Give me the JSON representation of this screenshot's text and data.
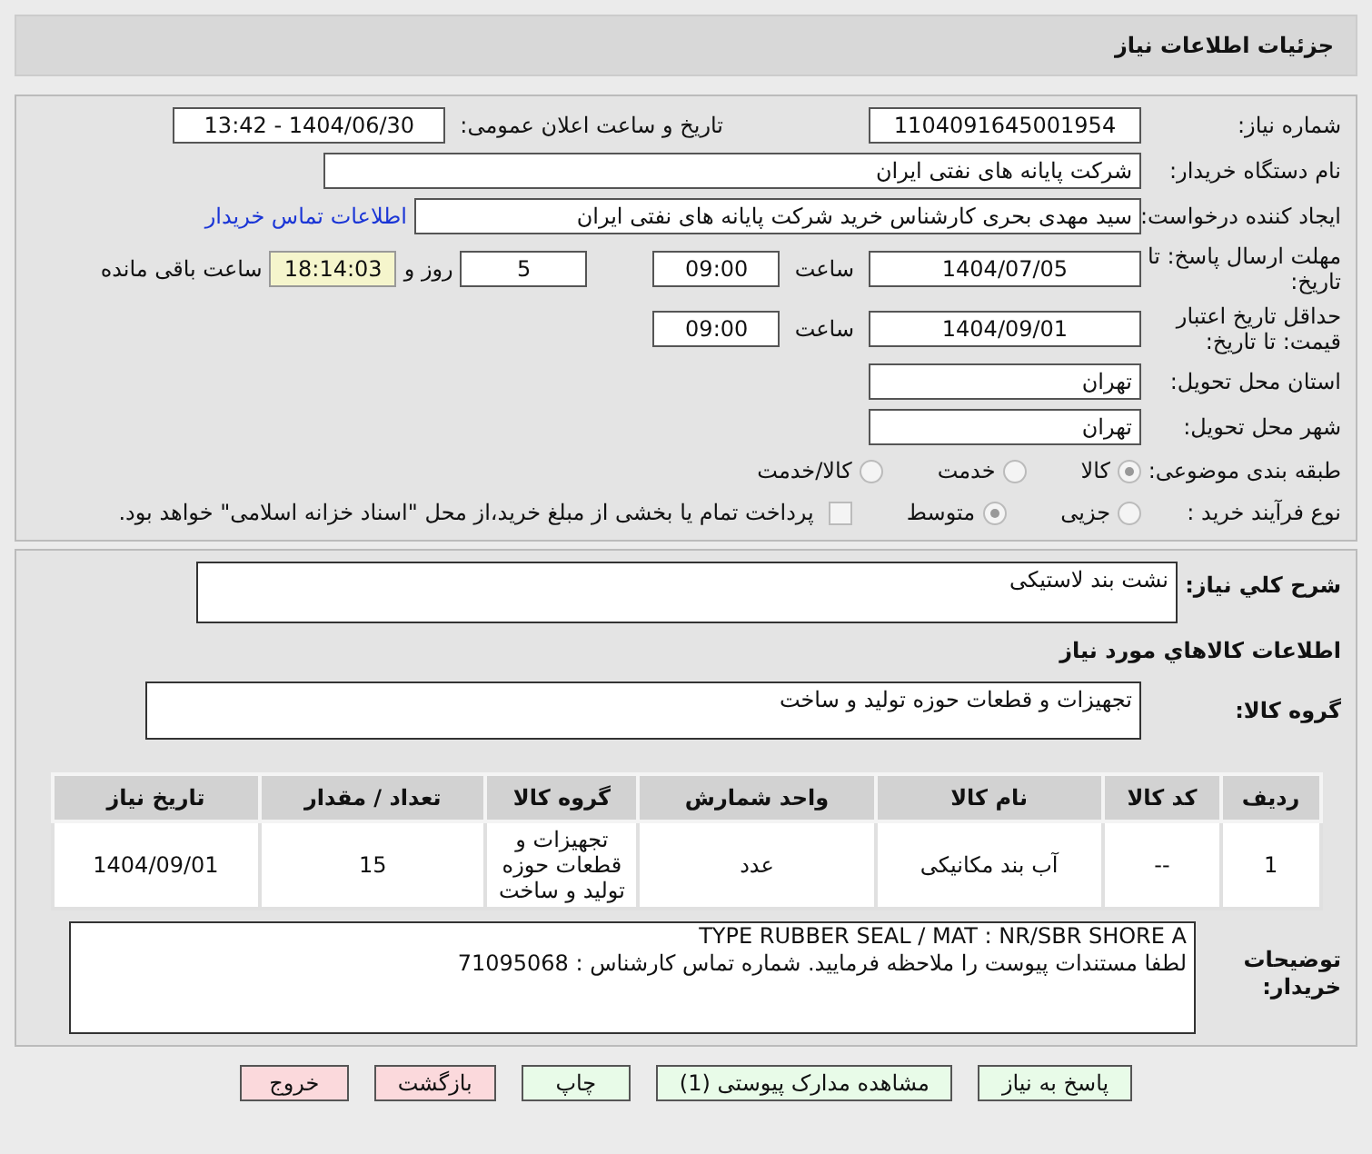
{
  "header": {
    "title": "جزئیات اطلاعات نیاز"
  },
  "need_number": {
    "label": "شماره نیاز:",
    "value": "1104091645001954"
  },
  "announce": {
    "label": "تاریخ و ساعت اعلان عمومی:",
    "value": "1404/06/30 - 13:42"
  },
  "buyer_org": {
    "label": "نام دستگاه خریدار:",
    "value": "شرکت پایانه های نفتی ایران"
  },
  "requester": {
    "label": "ایجاد کننده درخواست:",
    "value": "سید مهدی  بحری کارشناس خرید شرکت پایانه های نفتی ایران",
    "link": "اطلاعات تماس خریدار"
  },
  "deadline": {
    "label": "مهلت ارسال پاسخ: تا تاریخ:",
    "date": "1404/07/05",
    "time_label": "ساعت",
    "time": "09:00",
    "days": "5",
    "days_label": "روز و",
    "remaining": "18:14:03",
    "remaining_label": "ساعت باقی مانده"
  },
  "validity": {
    "label": "حداقل تاریخ اعتبار قیمت: تا تاریخ:",
    "date": "1404/09/01",
    "time_label": "ساعت",
    "time": "09:00"
  },
  "province": {
    "label": "استان محل تحویل:",
    "value": "تهران"
  },
  "city": {
    "label": "شهر محل تحویل:",
    "value": "تهران"
  },
  "category": {
    "label": "طبقه بندی موضوعی:",
    "options": [
      {
        "label": "کالا",
        "selected": true
      },
      {
        "label": "خدمت",
        "selected": false
      },
      {
        "label": "کالا/خدمت",
        "selected": false
      }
    ]
  },
  "process": {
    "label": "نوع فرآیند خرید :",
    "options": [
      {
        "label": "جزیی",
        "selected": false
      },
      {
        "label": "متوسط",
        "selected": true
      }
    ],
    "payment": {
      "label": "پرداخت تمام یا بخشی از مبلغ خرید،از محل \"اسناد خزانه اسلامی\" خواهد بود.",
      "checked": false
    }
  },
  "description": {
    "label": "شرح کلي نياز:",
    "value": "نشت بند لاستیکی"
  },
  "items_title": "اطلاعات کالاهاي مورد نياز",
  "goods_group": {
    "label": "گروه کالا:",
    "value": "تجهیزات و قطعات حوزه تولید و ساخت"
  },
  "table": {
    "columns": [
      "ردیف",
      "کد کالا",
      "نام کالا",
      "واحد شمارش",
      "گروه کالا",
      "تعداد / مقدار",
      "تاریخ نیاز"
    ],
    "rows": [
      [
        "1",
        "--",
        "آب بند مکانیکی",
        "عدد",
        "تجهیزات و قطعات حوزه تولید و ساخت",
        "15",
        "1404/09/01"
      ]
    ]
  },
  "buyer_notes": {
    "label": "توضیحات خریدار:",
    "lines": [
      "TYPE RUBBER SEAL / MAT : NR/SBR SHORE A",
      "لطفا مستندات پیوست را ملاحظه فرمایید. شماره تماس کارشناس : 71095068"
    ]
  },
  "buttons": [
    {
      "label": "پاسخ به نیاز",
      "kind": "primary"
    },
    {
      "label": "مشاهده مدارک پیوستی (1)",
      "kind": "primary"
    },
    {
      "label": "چاپ",
      "kind": "primary"
    },
    {
      "label": "بازگشت",
      "kind": "danger"
    },
    {
      "label": "خروج",
      "kind": "danger"
    }
  ]
}
